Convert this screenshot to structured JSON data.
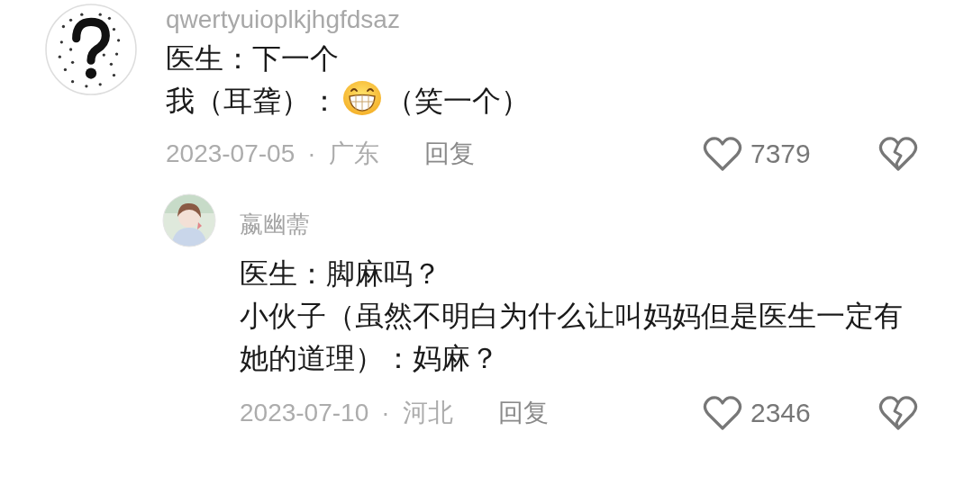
{
  "comments": [
    {
      "avatar": {
        "kind": "question"
      },
      "username": "qwertyuioplkjhgfdsaz",
      "lines": [
        [
          {
            "kind": "text",
            "text": "医生：下一个"
          }
        ],
        [
          {
            "kind": "text",
            "text": "我（耳聋）："
          },
          {
            "kind": "emoji"
          },
          {
            "kind": "text",
            "text": "（笑一个）"
          }
        ]
      ],
      "date": "2023-07-05",
      "separator": "·",
      "location": "广东",
      "reply": "回复",
      "likes": "7379",
      "nested": false
    },
    {
      "avatar": {
        "kind": "silhouette"
      },
      "username": "嬴幽薷",
      "lines": [
        [
          {
            "kind": "text",
            "text": "医生：脚麻吗？"
          }
        ],
        [
          {
            "kind": "text",
            "text": "小伙子（虽然不明白为什么让叫妈妈但是医生一定有她的道理）：妈麻？"
          }
        ]
      ],
      "date": "2023-07-10",
      "separator": "·",
      "location": "河北",
      "reply": "回复",
      "likes": "2346",
      "nested": true
    }
  ]
}
